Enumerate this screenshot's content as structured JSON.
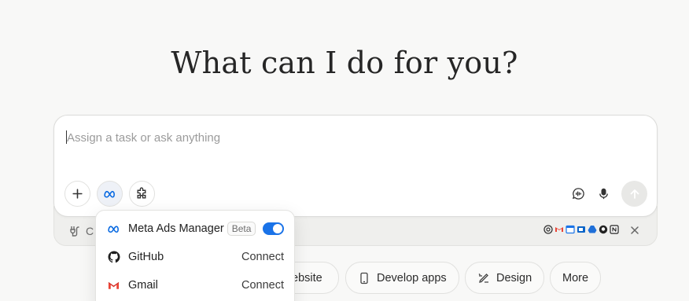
{
  "headline": "What can I do for you?",
  "composer": {
    "placeholder": "Assign a task or ask anything"
  },
  "strip": {
    "label": "C"
  },
  "chips": [
    {
      "label": "ebsite"
    },
    {
      "label": "Develop apps"
    },
    {
      "label": "Design"
    },
    {
      "label": "More"
    }
  ],
  "popover": {
    "items": [
      {
        "label": "Meta Ads Manager",
        "badge": "Beta",
        "enabled": true
      },
      {
        "label": "GitHub",
        "action": "Connect"
      },
      {
        "label": "Gmail",
        "action": "Connect"
      }
    ]
  },
  "colors": {
    "accent": "#1a73e8",
    "meta_blue": "#0668e1",
    "background": "#f8f8f7"
  }
}
